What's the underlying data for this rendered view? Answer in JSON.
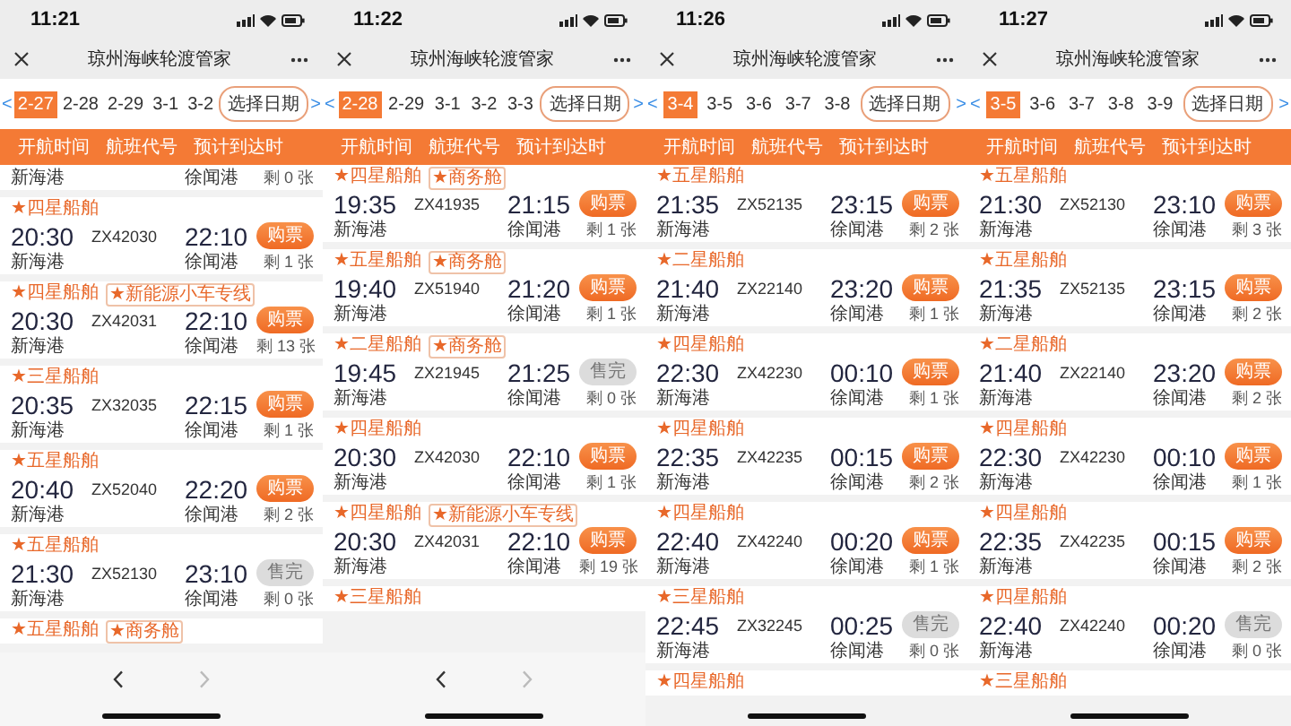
{
  "panels": [
    {
      "time": "11:21",
      "title": "琼州海峡轮渡管家",
      "prev": "<",
      "next": ">",
      "pick_date": "选择日期",
      "columns": [
        "开航时间",
        "航班代号",
        "预计到达时"
      ],
      "has_nav_bar": true,
      "dates": [
        {
          "label": "2-27",
          "selected": true
        },
        {
          "label": "2-28",
          "selected": false
        },
        {
          "label": "2-29",
          "selected": false
        },
        {
          "label": "3-1",
          "selected": false
        },
        {
          "label": "3-2",
          "selected": false
        }
      ],
      "flights": [
        {
          "from": "新海港",
          "to": "徐闻港",
          "remaining": "剩 0 张"
        },
        {
          "tag": "★四星船舶",
          "depart": "20:30",
          "code": "ZX42030",
          "arrive": "22:10",
          "button": "购票",
          "sold_out": false,
          "from": "新海港",
          "to": "徐闻港",
          "remaining": "剩 1 张"
        },
        {
          "tag": "★四星船舶",
          "badge": "★新能源小车专线",
          "depart": "20:30",
          "code": "ZX42031",
          "arrive": "22:10",
          "button": "购票",
          "sold_out": false,
          "from": "新海港",
          "to": "徐闻港",
          "remaining": "剩 13 张"
        },
        {
          "tag": "★三星船舶",
          "depart": "20:35",
          "code": "ZX32035",
          "arrive": "22:15",
          "button": "购票",
          "sold_out": false,
          "from": "新海港",
          "to": "徐闻港",
          "remaining": "剩 1 张"
        },
        {
          "tag": "★五星船舶",
          "depart": "20:40",
          "code": "ZX52040",
          "arrive": "22:20",
          "button": "购票",
          "sold_out": false,
          "from": "新海港",
          "to": "徐闻港",
          "remaining": "剩 2 张"
        },
        {
          "tag": "★五星船舶",
          "depart": "21:30",
          "code": "ZX52130",
          "arrive": "23:10",
          "button": "售完",
          "sold_out": true,
          "from": "新海港",
          "to": "徐闻港",
          "remaining": "剩 0 张"
        },
        {
          "tag": "★五星船舶",
          "badge": "★商务舱"
        }
      ]
    },
    {
      "time": "11:22",
      "title": "琼州海峡轮渡管家",
      "prev": "<",
      "next": ">",
      "pick_date": "选择日期",
      "columns": [
        "开航时间",
        "航班代号",
        "预计到达时"
      ],
      "has_nav_bar": true,
      "dates": [
        {
          "label": "2-28",
          "selected": true
        },
        {
          "label": "2-29",
          "selected": false
        },
        {
          "label": "3-1",
          "selected": false
        },
        {
          "label": "3-2",
          "selected": false
        },
        {
          "label": "3-3",
          "selected": false
        }
      ],
      "flights": [
        {
          "tag": "★四星船舶",
          "badge": "★商务舱",
          "depart": "19:35",
          "code": "ZX41935",
          "arrive": "21:15",
          "button": "购票",
          "sold_out": false,
          "from": "新海港",
          "to": "徐闻港",
          "remaining": "剩 1 张"
        },
        {
          "tag": "★五星船舶",
          "badge": "★商务舱",
          "depart": "19:40",
          "code": "ZX51940",
          "arrive": "21:20",
          "button": "购票",
          "sold_out": false,
          "from": "新海港",
          "to": "徐闻港",
          "remaining": "剩 1 张"
        },
        {
          "tag": "★二星船舶",
          "badge": "★商务舱",
          "depart": "19:45",
          "code": "ZX21945",
          "arrive": "21:25",
          "button": "售完",
          "sold_out": true,
          "from": "新海港",
          "to": "徐闻港",
          "remaining": "剩 0 张"
        },
        {
          "tag": "★四星船舶",
          "depart": "20:30",
          "code": "ZX42030",
          "arrive": "22:10",
          "button": "购票",
          "sold_out": false,
          "from": "新海港",
          "to": "徐闻港",
          "remaining": "剩 1 张"
        },
        {
          "tag": "★四星船舶",
          "badge": "★新能源小车专线",
          "depart": "20:30",
          "code": "ZX42031",
          "arrive": "22:10",
          "button": "购票",
          "sold_out": false,
          "from": "新海港",
          "to": "徐闻港",
          "remaining": "剩 19 张"
        },
        {
          "tag": "★三星船舶"
        }
      ]
    },
    {
      "time": "11:26",
      "title": "琼州海峡轮渡管家",
      "prev": "<",
      "next": ">",
      "pick_date": "选择日期",
      "columns": [
        "开航时间",
        "航班代号",
        "预计到达时"
      ],
      "has_nav_bar": false,
      "dates": [
        {
          "label": "3-4",
          "selected": true
        },
        {
          "label": "3-5",
          "selected": false
        },
        {
          "label": "3-6",
          "selected": false
        },
        {
          "label": "3-7",
          "selected": false
        },
        {
          "label": "3-8",
          "selected": false
        }
      ],
      "flights": [
        {
          "tag": "★五星船舶",
          "depart": "21:35",
          "code": "ZX52135",
          "arrive": "23:15",
          "button": "购票",
          "sold_out": false,
          "from": "新海港",
          "to": "徐闻港",
          "remaining": "剩 2 张"
        },
        {
          "tag": "★二星船舶",
          "depart": "21:40",
          "code": "ZX22140",
          "arrive": "23:20",
          "button": "购票",
          "sold_out": false,
          "from": "新海港",
          "to": "徐闻港",
          "remaining": "剩 1 张"
        },
        {
          "tag": "★四星船舶",
          "depart": "22:30",
          "code": "ZX42230",
          "arrive": "00:10",
          "button": "购票",
          "sold_out": false,
          "from": "新海港",
          "to": "徐闻港",
          "remaining": "剩 1 张"
        },
        {
          "tag": "★四星船舶",
          "depart": "22:35",
          "code": "ZX42235",
          "arrive": "00:15",
          "button": "购票",
          "sold_out": false,
          "from": "新海港",
          "to": "徐闻港",
          "remaining": "剩 2 张"
        },
        {
          "tag": "★四星船舶",
          "depart": "22:40",
          "code": "ZX42240",
          "arrive": "00:20",
          "button": "购票",
          "sold_out": false,
          "from": "新海港",
          "to": "徐闻港",
          "remaining": "剩 1 张"
        },
        {
          "tag": "★三星船舶",
          "depart": "22:45",
          "code": "ZX32245",
          "arrive": "00:25",
          "button": "售完",
          "sold_out": true,
          "from": "新海港",
          "to": "徐闻港",
          "remaining": "剩 0 张"
        },
        {
          "tag": "★四星船舶"
        }
      ]
    },
    {
      "time": "11:27",
      "title": "琼州海峡轮渡管家",
      "prev": "<",
      "next": ">",
      "pick_date": "选择日期",
      "columns": [
        "开航时间",
        "航班代号",
        "预计到达时"
      ],
      "has_nav_bar": false,
      "dates": [
        {
          "label": "3-5",
          "selected": true
        },
        {
          "label": "3-6",
          "selected": false
        },
        {
          "label": "3-7",
          "selected": false
        },
        {
          "label": "3-8",
          "selected": false
        },
        {
          "label": "3-9",
          "selected": false
        }
      ],
      "flights": [
        {
          "tag": "★五星船舶",
          "depart": "21:30",
          "code": "ZX52130",
          "arrive": "23:10",
          "button": "购票",
          "sold_out": false,
          "from": "新海港",
          "to": "徐闻港",
          "remaining": "剩 3 张"
        },
        {
          "tag": "★五星船舶",
          "depart": "21:35",
          "code": "ZX52135",
          "arrive": "23:15",
          "button": "购票",
          "sold_out": false,
          "from": "新海港",
          "to": "徐闻港",
          "remaining": "剩 2 张"
        },
        {
          "tag": "★二星船舶",
          "depart": "21:40",
          "code": "ZX22140",
          "arrive": "23:20",
          "button": "购票",
          "sold_out": false,
          "from": "新海港",
          "to": "徐闻港",
          "remaining": "剩 2 张"
        },
        {
          "tag": "★四星船舶",
          "depart": "22:30",
          "code": "ZX42230",
          "arrive": "00:10",
          "button": "购票",
          "sold_out": false,
          "from": "新海港",
          "to": "徐闻港",
          "remaining": "剩 1 张"
        },
        {
          "tag": "★四星船舶",
          "depart": "22:35",
          "code": "ZX42235",
          "arrive": "00:15",
          "button": "购票",
          "sold_out": false,
          "from": "新海港",
          "to": "徐闻港",
          "remaining": "剩 2 张"
        },
        {
          "tag": "★四星船舶",
          "depart": "22:40",
          "code": "ZX42240",
          "arrive": "00:20",
          "button": "售完",
          "sold_out": true,
          "from": "新海港",
          "to": "徐闻港",
          "remaining": "剩 0 张"
        },
        {
          "tag": "★三星船舶"
        }
      ]
    }
  ]
}
